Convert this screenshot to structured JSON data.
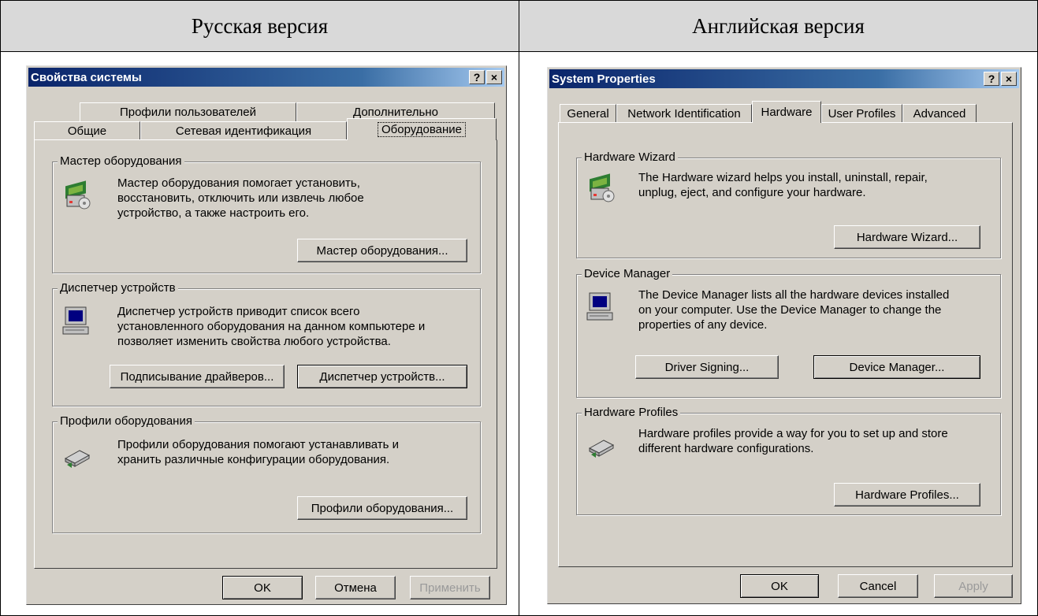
{
  "headers": {
    "left": "Русская версия",
    "right": "Английская версия"
  },
  "ru": {
    "title": "Свойства системы",
    "help_btn": "?",
    "close_btn": "×",
    "tabs_back": [
      "Профили пользователей",
      "Дополнительно"
    ],
    "tabs_front": [
      "Общие",
      "Сетевая идентификация",
      "Оборудование"
    ],
    "wizard": {
      "title": "Мастер оборудования",
      "text": [
        "Мастер оборудования помогает установить,",
        "восстановить, отключить или извлечь любое",
        "устройство, а также настроить его."
      ],
      "button": "Мастер оборудования..."
    },
    "devmgr": {
      "title": "Диспетчер устройств",
      "text": [
        "Диспетчер устройств приводит список всего",
        "установленного оборудования на данном компьютере и",
        "позволяет изменить свойства любого устройства."
      ],
      "btn_sign": "Подписывание драйверов...",
      "btn_mgr": "Диспетчер устройств..."
    },
    "profiles": {
      "title": "Профили оборудования",
      "text": [
        "Профили оборудования помогают устанавливать и",
        "хранить различные конфигурации оборудования."
      ],
      "button": "Профили оборудования..."
    },
    "ok": "OK",
    "cancel": "Отмена",
    "apply": "Применить"
  },
  "en": {
    "title": "System Properties",
    "help_btn": "?",
    "close_btn": "×",
    "tabs": [
      "General",
      "Network Identification",
      "Hardware",
      "User Profiles",
      "Advanced"
    ],
    "wizard": {
      "title": "Hardware Wizard",
      "text": [
        "The Hardware wizard helps you install, uninstall, repair,",
        "unplug, eject, and configure your hardware."
      ],
      "button": "Hardware Wizard..."
    },
    "devmgr": {
      "title": "Device Manager",
      "text": [
        "The Device Manager lists all the hardware devices installed",
        "on your computer. Use the Device Manager to change the",
        "properties of any device."
      ],
      "btn_sign": "Driver Signing...",
      "btn_mgr": "Device Manager..."
    },
    "profiles": {
      "title": "Hardware Profiles",
      "text": [
        "Hardware profiles provide a way for you to set up and store",
        "different hardware configurations."
      ],
      "button": "Hardware Profiles..."
    },
    "ok": "OK",
    "cancel": "Cancel",
    "apply": "Apply"
  },
  "icons": [
    "hardware-wizard-icon",
    "computer-icon",
    "hardware-profiles-icon"
  ],
  "colors": {
    "dialog": "#d4d0c8",
    "title_start": "#0a246a",
    "title_end": "#a6caf0",
    "highlight": "#e8141e",
    "header_bg": "#d9d9d9"
  }
}
